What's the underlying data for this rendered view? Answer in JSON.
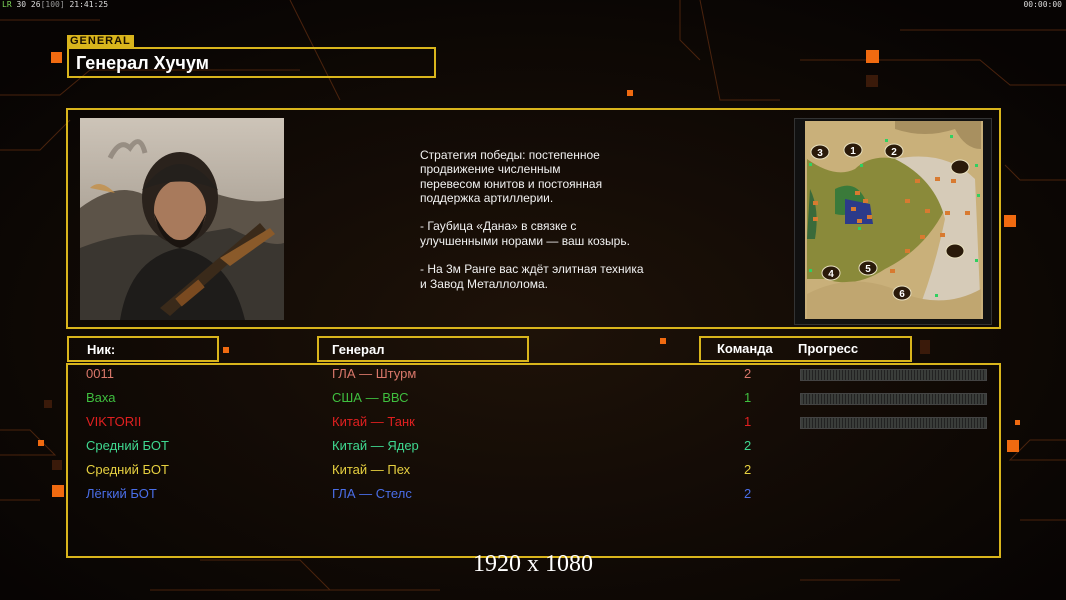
{
  "hud": {
    "fps_label": "LR",
    "fps_values": "30 26",
    "bracket": "[100]",
    "clock": "21:41:25",
    "timer": "00:00:00"
  },
  "header": {
    "tag": "GENERAL",
    "title": "Генерал Хучум"
  },
  "description": "Стратегия победы: постепенное\nпродвижение численным\nперевесом юнитов и постоянная\nподдержка артиллерии.\n\n- Гаубица «Дана» в связке с\nулучшенными норами — ваш козырь.\n\n- На 3м Ранге вас ждёт элитная техника\nи Завод Металлолома.",
  "map": {
    "slots": [
      "1",
      "2",
      "3",
      "4",
      "5",
      "6"
    ]
  },
  "columns": {
    "nick": "Ник:",
    "general": "Генерал",
    "team": "Команда",
    "progress": "Прогресс"
  },
  "players": [
    {
      "nick": "0011",
      "general": "ГЛА — Штурм",
      "team": "2",
      "color": "#d9776a",
      "progress": 0
    },
    {
      "nick": "Ваха",
      "general": "США — ВВС",
      "team": "1",
      "color": "#3fbf3f",
      "progress": 0
    },
    {
      "nick": "VIKTORII",
      "general": "Китай — Танк",
      "team": "1",
      "color": "#e02020",
      "progress": 0
    },
    {
      "nick": "Средний БОТ",
      "general": "Китай — Ядер",
      "team": "2",
      "color": "#3fd890",
      "progress": null
    },
    {
      "nick": "Средний БОТ",
      "general": "Китай — Пех",
      "team": "2",
      "color": "#e6d040",
      "progress": null
    },
    {
      "nick": "Лёгкий БОТ",
      "general": "ГЛА — Стелс",
      "team": "2",
      "color": "#4a6ee8",
      "progress": null
    }
  ],
  "resolution": "1920 x 1080"
}
